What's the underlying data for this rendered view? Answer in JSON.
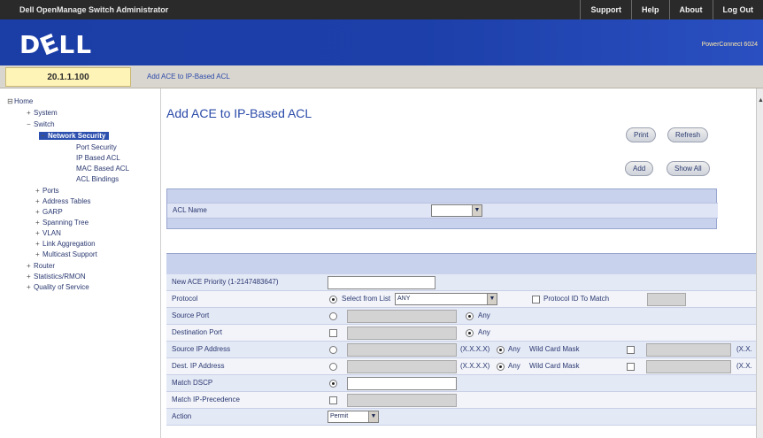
{
  "topbar": {
    "app_title": "Dell OpenManage Switch Administrator",
    "links": [
      "Support",
      "Help",
      "About",
      "Log Out"
    ]
  },
  "brand": {
    "logo_text": "DELL",
    "product_name": "PowerConnect 6024"
  },
  "ipbar": {
    "ip_address": "20.1.1.100",
    "breadcrumb": "Add ACE to IP-Based ACL"
  },
  "tree": {
    "home": "Home",
    "system": "System",
    "switch": "Switch",
    "network_security": "Network Security",
    "port_security": "Port Security",
    "ip_based_acl": "IP Based ACL",
    "mac_based_acl": "MAC Based ACL",
    "acl_bindings": "ACL Bindings",
    "ports": "Ports",
    "address_tables": "Address Tables",
    "garp": "GARP",
    "spanning_tree": "Spanning Tree",
    "vlan": "VLAN",
    "link_aggregation": "Link Aggregation",
    "multicast_support": "Multicast Support",
    "router": "Router",
    "statistics_rmon": "Statistics/RMON",
    "quality_of_service": "Quality of Service"
  },
  "main": {
    "title": "Add ACE to IP-Based ACL",
    "buttons": {
      "print": "Print",
      "refresh": "Refresh",
      "add": "Add",
      "show_all": "Show All"
    },
    "acl_name_label": "ACL Name",
    "acl_name_value": "",
    "fields": {
      "new_ace_priority": "New ACE Priority (1-2147483647)",
      "protocol": "Protocol",
      "select_from_list": "Select from List",
      "protocol_value": "ANY",
      "protocol_id_to_match": "Protocol ID To Match",
      "protocol_id_value": "",
      "source_port": "Source Port",
      "destination_port": "Destination Port",
      "any": "Any",
      "source_ip": "Source IP Address",
      "dest_ip": "Dest. IP Address",
      "ip_hint": "(X.X.X.X)",
      "wild_card_mask": "Wild Card Mask",
      "mask_hint": "(X.X.",
      "match_dscp": "Match DSCP",
      "match_ip_precedence": "Match IP-Precedence",
      "action": "Action",
      "action_value": "Permit"
    }
  },
  "colors": {
    "brand_blue": "#1c3fa9",
    "ip_box_yellow": "#fff4b8",
    "panel_blue": "#c9d2ec",
    "row_alt": "#e4e9f6",
    "selected_node": "#2b4fae"
  }
}
